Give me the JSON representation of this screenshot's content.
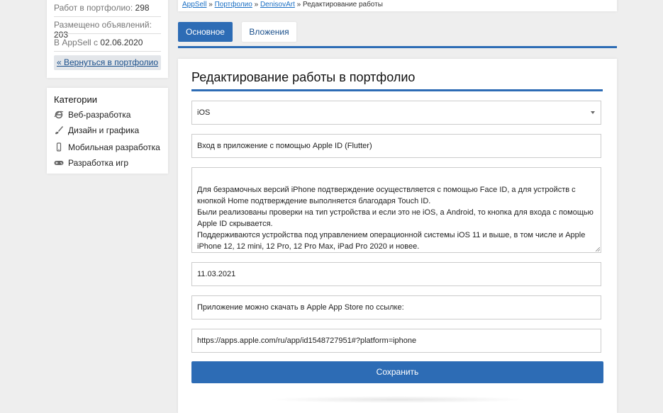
{
  "profile": {
    "portfolio_count_label": "Работ в портфолио:",
    "portfolio_count_value": "298",
    "ads_count_label": "Размещено объявлений:",
    "ads_count_value": "203",
    "member_since_label": "В AppSell с",
    "member_since_value": "02.06.2020",
    "back_label": "« Вернуться в портфолио"
  },
  "categories": {
    "title": "Категории",
    "items": [
      {
        "label": "Веб-разработка",
        "icon": "ie-icon"
      },
      {
        "label": "Дизайн и графика",
        "icon": "brush-icon"
      },
      {
        "label": "Мобильная разработка",
        "icon": "phone-icon"
      },
      {
        "label": "Разработка игр",
        "icon": "gamepad-icon"
      }
    ]
  },
  "breadcrumb": {
    "items": [
      "AppSell",
      "Портфолио",
      "DenisovArt"
    ],
    "current": "Редактирование работы",
    "separator": "»"
  },
  "tabs": {
    "main": "Основное",
    "attachments": "Вложения"
  },
  "form": {
    "title": "Редактирование работы в портфолио",
    "platform": "iOS",
    "work_title": "Вход в приложение с помощью Apple ID (Flutter)",
    "description_lines": [
      "Для безрамочных версий iPhone подтверждение осуществляется с помощью Face ID, а для устройств с кнопкой Home подтверждение выполняется благодаря Touch ID.",
      "Были реализованы проверки на тип устройства и если это не iOS, а Android, то кнопка для входа с помощью Apple ID скрывается.",
      "Поддерживаются устройства под управлением операционной системы iOS 11 и выше, в том числе и Apple iPhone 12, 12 mini, 12 Pro, 12 Pro Max, iPad Pro 2020 и новее."
    ],
    "date": "11.03.2021",
    "link_text": "Приложение можно скачать в Apple App Store по ссылке:",
    "link_url": "https://apps.apple.com/ru/app/id1548727951#?platform=iphone",
    "save_label": "Сохранить"
  },
  "colors": {
    "accent": "#2d6cb5",
    "link": "#1a6fc4"
  }
}
